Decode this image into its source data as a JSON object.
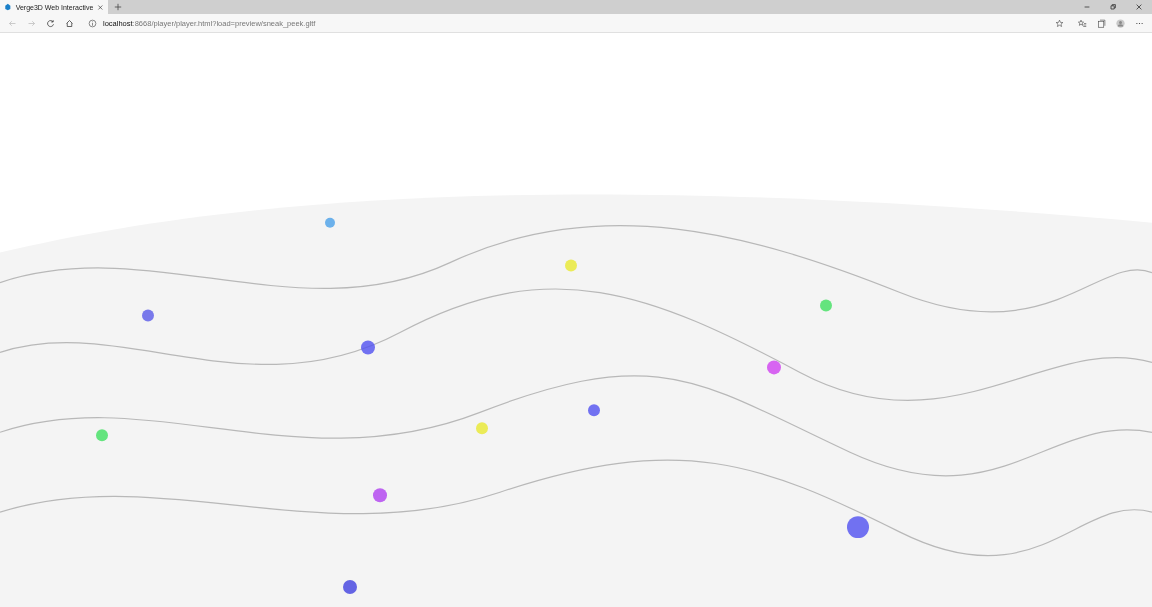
{
  "tabs": [
    {
      "title": "Verge3D Web Interactive",
      "selected": true
    }
  ],
  "address_bar": {
    "url": "**localhost**:8668/player/player.html?load=preview/sneak_peek.gltf"
  }
}
